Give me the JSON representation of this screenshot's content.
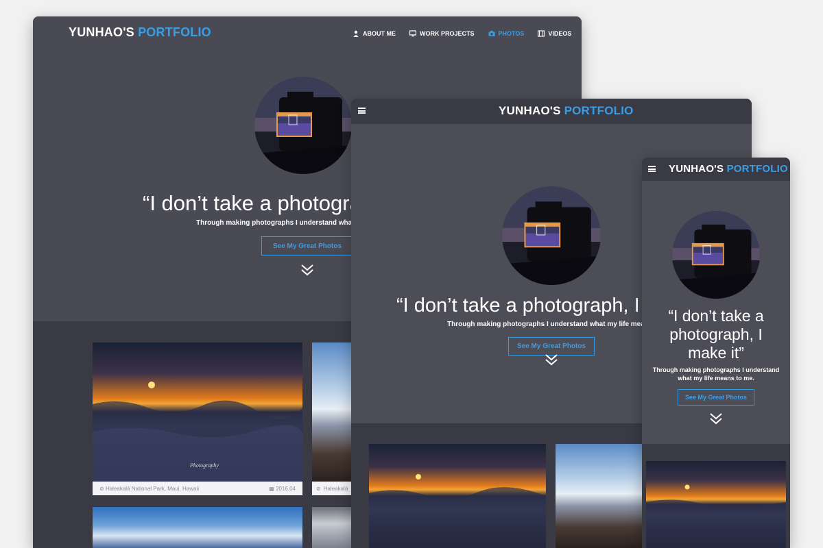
{
  "brand": {
    "name": "YUNHAO'S",
    "accent": "PORTFOLIO",
    "accent_color": "#3a9ee6"
  },
  "nav": [
    {
      "label": "ABOUT ME",
      "icon": "person-icon",
      "active": false
    },
    {
      "label": "WORK PROJECTS",
      "icon": "monitor-icon",
      "active": false
    },
    {
      "label": "PHOTOS",
      "icon": "camera-icon",
      "active": true
    },
    {
      "label": "VIDEOS",
      "icon": "film-icon",
      "active": false
    }
  ],
  "hero": {
    "quote_desktop": "“I don’t take a photogra",
    "quote_tablet": "“I don’t take a photograph, I m",
    "quote_mobile": "“I don’t take a photograph, I make it”",
    "sub_desktop": "Through making photographs I understand what",
    "sub_tablet": "Through making photographs I understand what my life means to",
    "sub_mobile": "Through making photographs I understand what my life means to me.",
    "cta": "See My Great Photos"
  },
  "cards": [
    {
      "location": "Haleakalā National Park, Maui, Hawaii",
      "date": "2016.04",
      "watermark": "Photography"
    },
    {
      "location": "Haleakalā"
    }
  ]
}
